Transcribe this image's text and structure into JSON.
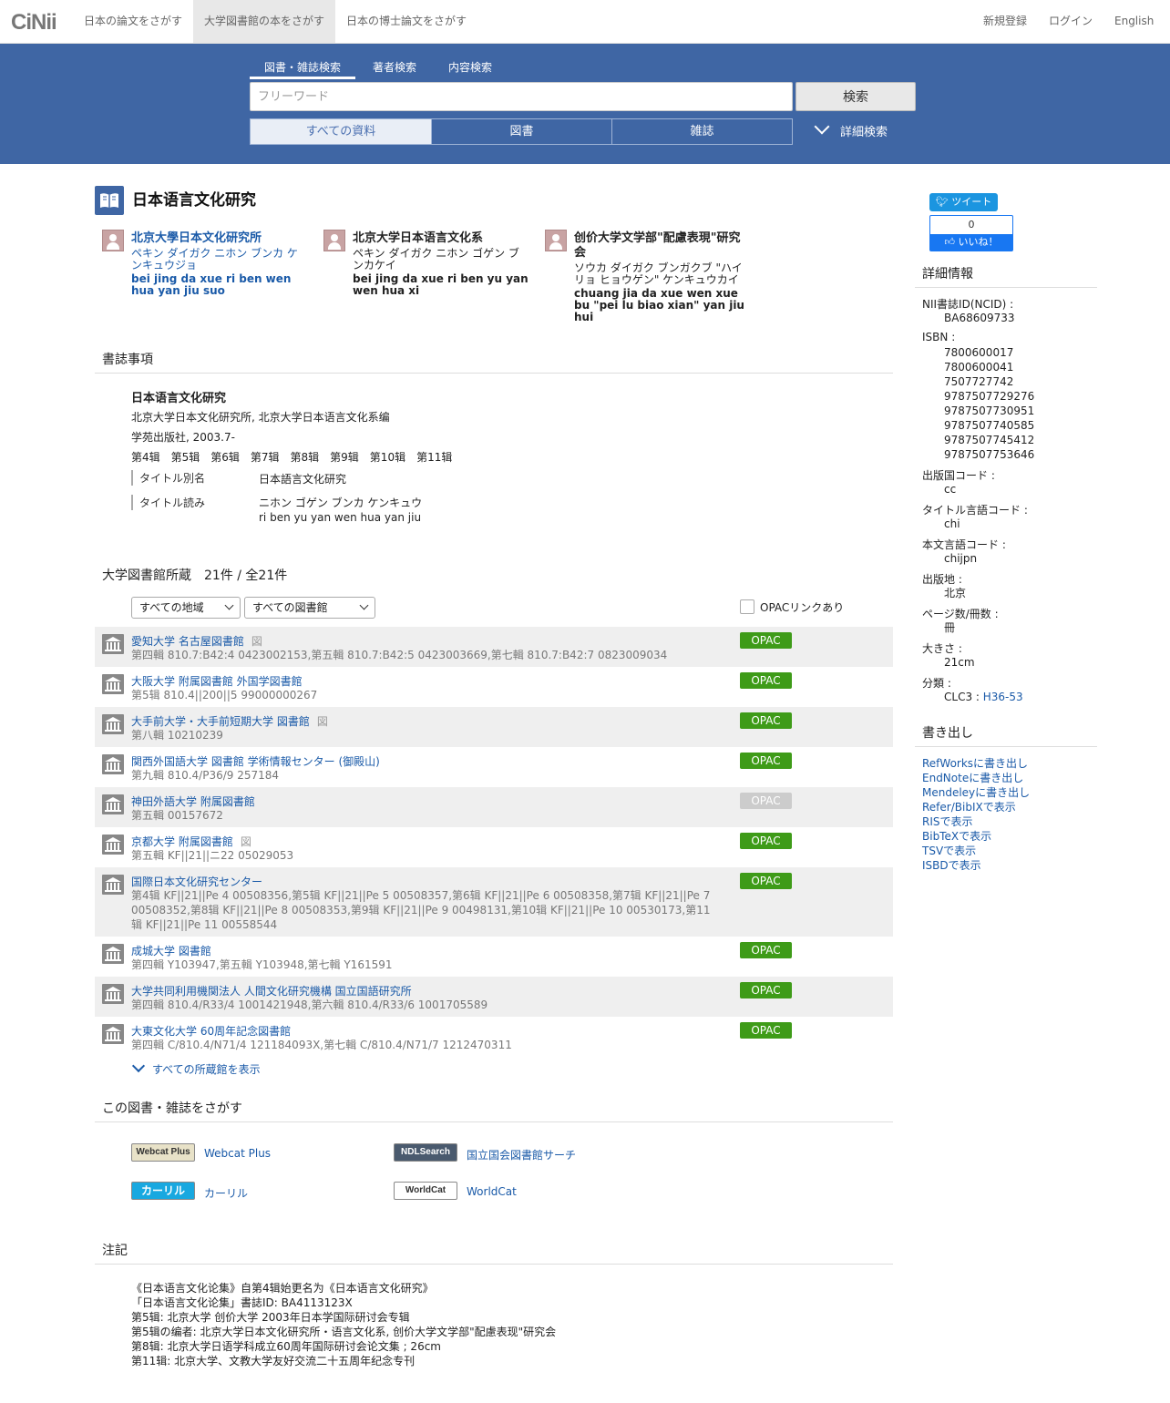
{
  "nav": {
    "logo": "CiNii",
    "tabs": [
      "日本の論文をさがす",
      "大学図書館の本をさがす",
      "日本の博士論文をさがす"
    ],
    "right": [
      "新規登録",
      "ログイン",
      "English"
    ]
  },
  "search": {
    "tabs": [
      "図書・雑誌検索",
      "著者検索",
      "内容検索"
    ],
    "placeholder": "フリーワード",
    "button": "検索",
    "filters": [
      "すべての資料",
      "図書",
      "雑誌"
    ],
    "advanced": "詳細検索"
  },
  "book": {
    "title": "日本语言文化研究",
    "authors": [
      {
        "name": "北京大學日本文化研究所",
        "kana": "ペキン ダイガク ニホン ブンカ ケンキュウジョ",
        "roman": "bei jing da xue ri ben wen hua yan jiu suo"
      },
      {
        "name": "北京大学日本语言文化系",
        "kana": "ペキン ダイガク ニホン ゴゲン ブンカケイ",
        "roman": "bei jing da xue ri ben yu yan wen hua xi"
      },
      {
        "name": "创价大学文学部\"配慮表現\"研究会",
        "kana": "ソウカ ダイガク ブンガクブ \"ハイリョ ヒョウゲン\" ケンキュウカイ",
        "roman": "chuang jia da xue wen xue bu \"pei lu biao xian\" yan jiu hui"
      }
    ]
  },
  "bibliography": {
    "heading": "書誌事項",
    "title": "日本语言文化研究",
    "responsibility": "北京大学日本文化研究所, 北京大学日本语言文化系编",
    "publisher": "学苑出版社, 2003.7-",
    "volumes": "第4辑　第5辑　第6辑　第7辑　第8辑　第9辑　第10辑　第11辑",
    "alt_title_label": "タイトル別名",
    "alt_title": "日本語言文化研究",
    "reading_label": "タイトル読み",
    "reading_kana": "ニホン ゴゲン ブンカ ケンキュウ",
    "reading_roman": "ri ben yu yan wen hua yan jiu"
  },
  "holdings": {
    "heading": "大学図書館所蔵　21件 / 全21件",
    "region_select": "すべての地域",
    "library_select": "すべての図書館",
    "opac_filter": "OPACリンクあり",
    "opac_label": "OPAC",
    "ill_mark": "図",
    "show_all": "すべての所蔵館を表示",
    "rows": [
      {
        "name": "愛知大学 名古屋図書館",
        "ill": true,
        "hold": "第四輯  810.7:B42:4  0423002153,第五輯  810.7:B42:5  0423003669,第七輯  810.7:B42:7  0823009034",
        "opac": true
      },
      {
        "name": "大阪大学 附属図書館 外国学図書館",
        "ill": false,
        "hold": "第5辑  810.4||200||5  99000000267",
        "opac": true
      },
      {
        "name": "大手前大学・大手前短期大学 図書館",
        "ill": true,
        "hold": "第八輯  10210239",
        "opac": true
      },
      {
        "name": "関西外国語大学 図書館 学術情報センター (御殿山)",
        "ill": false,
        "hold": "第九輯  810.4/P36/9  257184",
        "opac": true
      },
      {
        "name": "神田外語大学 附属図書館",
        "ill": false,
        "hold": "第五輯  00157672",
        "opac": false
      },
      {
        "name": "京都大学 附属図書館",
        "ill": true,
        "hold": "第五輯  KF||21||ニ22  05029053",
        "opac": true
      },
      {
        "name": "国際日本文化研究センター",
        "ill": false,
        "hold": "第4辑  KF||21||Pe 4  00508356,第5辑  KF||21||Pe 5  00508357,第6辑  KF||21||Pe 6  00508358,第7辑  KF||21||Pe 7  00508352,第8辑  KF||21||Pe 8  00508353,第9辑  KF||21||Pe 9  00498131,第10辑  KF||21||Pe 10  00530173,第11辑  KF||21||Pe 11  00558544",
        "opac": true
      },
      {
        "name": "成城大学 図書館",
        "ill": false,
        "hold": "第四輯  Y103947,第五輯  Y103948,第七輯  Y161591",
        "opac": true
      },
      {
        "name": "大学共同利用機関法人 人間文化研究機構 国立国語研究所",
        "ill": false,
        "hold": "第四輯  810.4/R33/4  1001421948,第六輯  810.4/R33/6  1001705589",
        "opac": true
      },
      {
        "name": "大東文化大学 60周年記念図書館",
        "ill": false,
        "hold": "第四輯  C/810.4/N71/4  121184093X,第七輯  C/810.4/N71/7  1212470311",
        "opac": true
      }
    ]
  },
  "find": {
    "heading": "この図書・雑誌をさがす",
    "links": [
      {
        "logo": "Webcat Plus",
        "label": "Webcat Plus"
      },
      {
        "logo": "NDLSearch",
        "label": "国立国会図書館サーチ"
      },
      {
        "logo": "カーリル",
        "label": "カーリル"
      },
      {
        "logo": "WorldCat",
        "label": "WorldCat"
      }
    ]
  },
  "notes": {
    "heading": "注記",
    "lines": [
      "《日本语言文化论集》自第4辑始更名为《日本语言文化研究》",
      "「日本语言文化论集」書誌ID: BA4113123X",
      "第5辑: 北京大学 创价大学 2003年日本学国际研讨会专辑",
      "第5辑の编者: 北京大学日本文化研究所・语言文化系, 创价大学文学部\"配慮表现\"研究会",
      "第8辑: 北京大学日语学科成立60周年国际研讨会论文集 ; 26cm",
      "第11辑: 北京大学、文教大学友好交流二十五周年纪念专刊"
    ]
  },
  "sidebar": {
    "tweet": "ツイート",
    "like_count": "0",
    "like": "いいね！",
    "details_heading": "詳細情報",
    "ncid_label": "NII書誌ID(NCID)",
    "ncid": "BA68609733",
    "isbn_label": "ISBN",
    "isbns": [
      "7800600017",
      "7800600041",
      "7507727742",
      "9787507729276",
      "9787507730951",
      "9787507740585",
      "9787507745412",
      "9787507753646"
    ],
    "country_label": "出版国コード",
    "country": "cc",
    "title_lang_label": "タイトル言語コード",
    "title_lang": "chi",
    "text_lang_label": "本文言語コード",
    "text_lang": "chijpn",
    "place_label": "出版地",
    "place": "北京",
    "pages_label": "ページ数/冊数",
    "pages": "冊",
    "size_label": "大きさ",
    "size": "21cm",
    "class_label": "分類",
    "class_prefix": "CLC3 :",
    "class_value": "H36-53",
    "export_heading": "書き出し",
    "exports": [
      "RefWorksに書き出し",
      "EndNoteに書き出し",
      "Mendeleyに書き出し",
      "Refer/BibIXで表示",
      "RISで表示",
      "BibTeXで表示",
      "TSVで表示",
      "ISBDで表示"
    ]
  }
}
